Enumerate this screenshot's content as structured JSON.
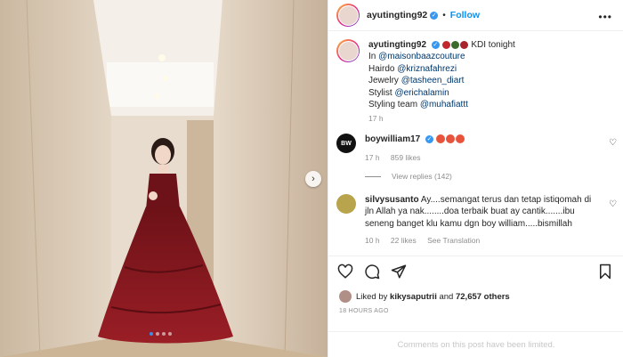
{
  "post": {
    "username": "ayutingting92",
    "follow_label": "Follow",
    "separator": "•",
    "more_label": "•••"
  },
  "caption": {
    "username": "ayutingting92",
    "title_rest": "KDI tonight",
    "line_in_prefix": "In ",
    "line_in_mention": "@maisonbaazcouture",
    "line_hair_prefix": "Hairdo ",
    "line_hair_mention": "@kriznafahrezi",
    "line_jewelry_prefix": "Jewelry ",
    "line_jewelry_mention": "@tasheen_diart",
    "line_stylist_prefix": "Stylist ",
    "line_stylist_mention": "@erichalamin",
    "line_team_prefix": "Styling team ",
    "line_team_mention": "@muhafiattt",
    "time": "17 h"
  },
  "comments": [
    {
      "username": "boywilliam17",
      "time": "17 h",
      "likes": "859 likes",
      "view_replies": "View replies (142)"
    },
    {
      "username": "silvysusanto",
      "text": "Ay....semangat terus dan tetap istiqomah di jln Allah ya nak........doa terbaik buat ay cantik.......ibu seneng banget klu kamu dgn boy william.....bismillah",
      "time": "10 h",
      "likes": "22 likes",
      "translate": "See Translation"
    }
  ],
  "actions": {
    "liked_prefix": "Liked by ",
    "liked_user": "kikysaputrii",
    "liked_and": " and ",
    "liked_count": "72,657 others",
    "timestamp": "18 HOURS AGO"
  },
  "footer": {
    "text": "Comments on this post have been limited."
  },
  "colors": {
    "accent": "#0095f6",
    "verified": "#3897f0",
    "dress": "#8b1a1f",
    "wall": "#d9c8b3"
  }
}
